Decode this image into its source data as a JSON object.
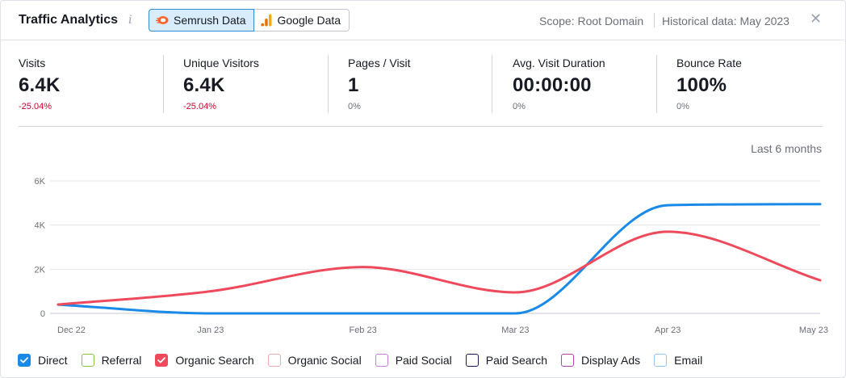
{
  "header": {
    "title": "Traffic Analytics",
    "info_icon": "i",
    "toggle": {
      "semrush_label": "Semrush Data",
      "google_label": "Google Data"
    },
    "scope": "Scope: Root Domain",
    "historical": "Historical data: May 2023",
    "close_glyph": "✕"
  },
  "metrics": [
    {
      "label": "Visits",
      "value": "6.4K",
      "delta": "-25.04%",
      "negative": true
    },
    {
      "label": "Unique Visitors",
      "value": "6.4K",
      "delta": "-25.04%",
      "negative": true
    },
    {
      "label": "Pages / Visit",
      "value": "1",
      "delta": "0%",
      "negative": false
    },
    {
      "label": "Avg. Visit Duration",
      "value": "00:00:00",
      "delta": "0%",
      "negative": false
    },
    {
      "label": "Bounce Rate",
      "value": "100%",
      "delta": "0%",
      "negative": false
    }
  ],
  "period_label": "Last 6 months",
  "chart_data": {
    "type": "line",
    "x": [
      "Dec 22",
      "Jan 23",
      "Feb 23",
      "Mar 23",
      "Apr 23",
      "May 23"
    ],
    "ylim": [
      0,
      6000
    ],
    "yticks": [
      0,
      2000,
      4000,
      6000
    ],
    "ytick_labels": [
      "0",
      "2K",
      "4K",
      "6K"
    ],
    "grid": true,
    "series": [
      {
        "name": "Direct",
        "color": "#1a8ae8",
        "values": [
          400,
          0,
          0,
          0,
          4900,
          4950
        ]
      },
      {
        "name": "Organic Search",
        "color": "#ee4a5b",
        "values": [
          400,
          1000,
          2100,
          950,
          3700,
          1500
        ]
      }
    ]
  },
  "legend": [
    {
      "label": "Direct",
      "color": "#1a8ae8",
      "checked": true
    },
    {
      "label": "Referral",
      "color": "#8bc34a",
      "checked": false
    },
    {
      "label": "Organic Search",
      "color": "#ee4a5b",
      "checked": true
    },
    {
      "label": "Organic Social",
      "color": "#f5a9b0",
      "checked": false
    },
    {
      "label": "Paid Social",
      "color": "#c77ddb",
      "checked": false
    },
    {
      "label": "Paid Search",
      "color": "#1c1850",
      "checked": false
    },
    {
      "label": "Display Ads",
      "color": "#b640b0",
      "checked": false
    },
    {
      "label": "Email",
      "color": "#92c5f2",
      "checked": false
    }
  ]
}
